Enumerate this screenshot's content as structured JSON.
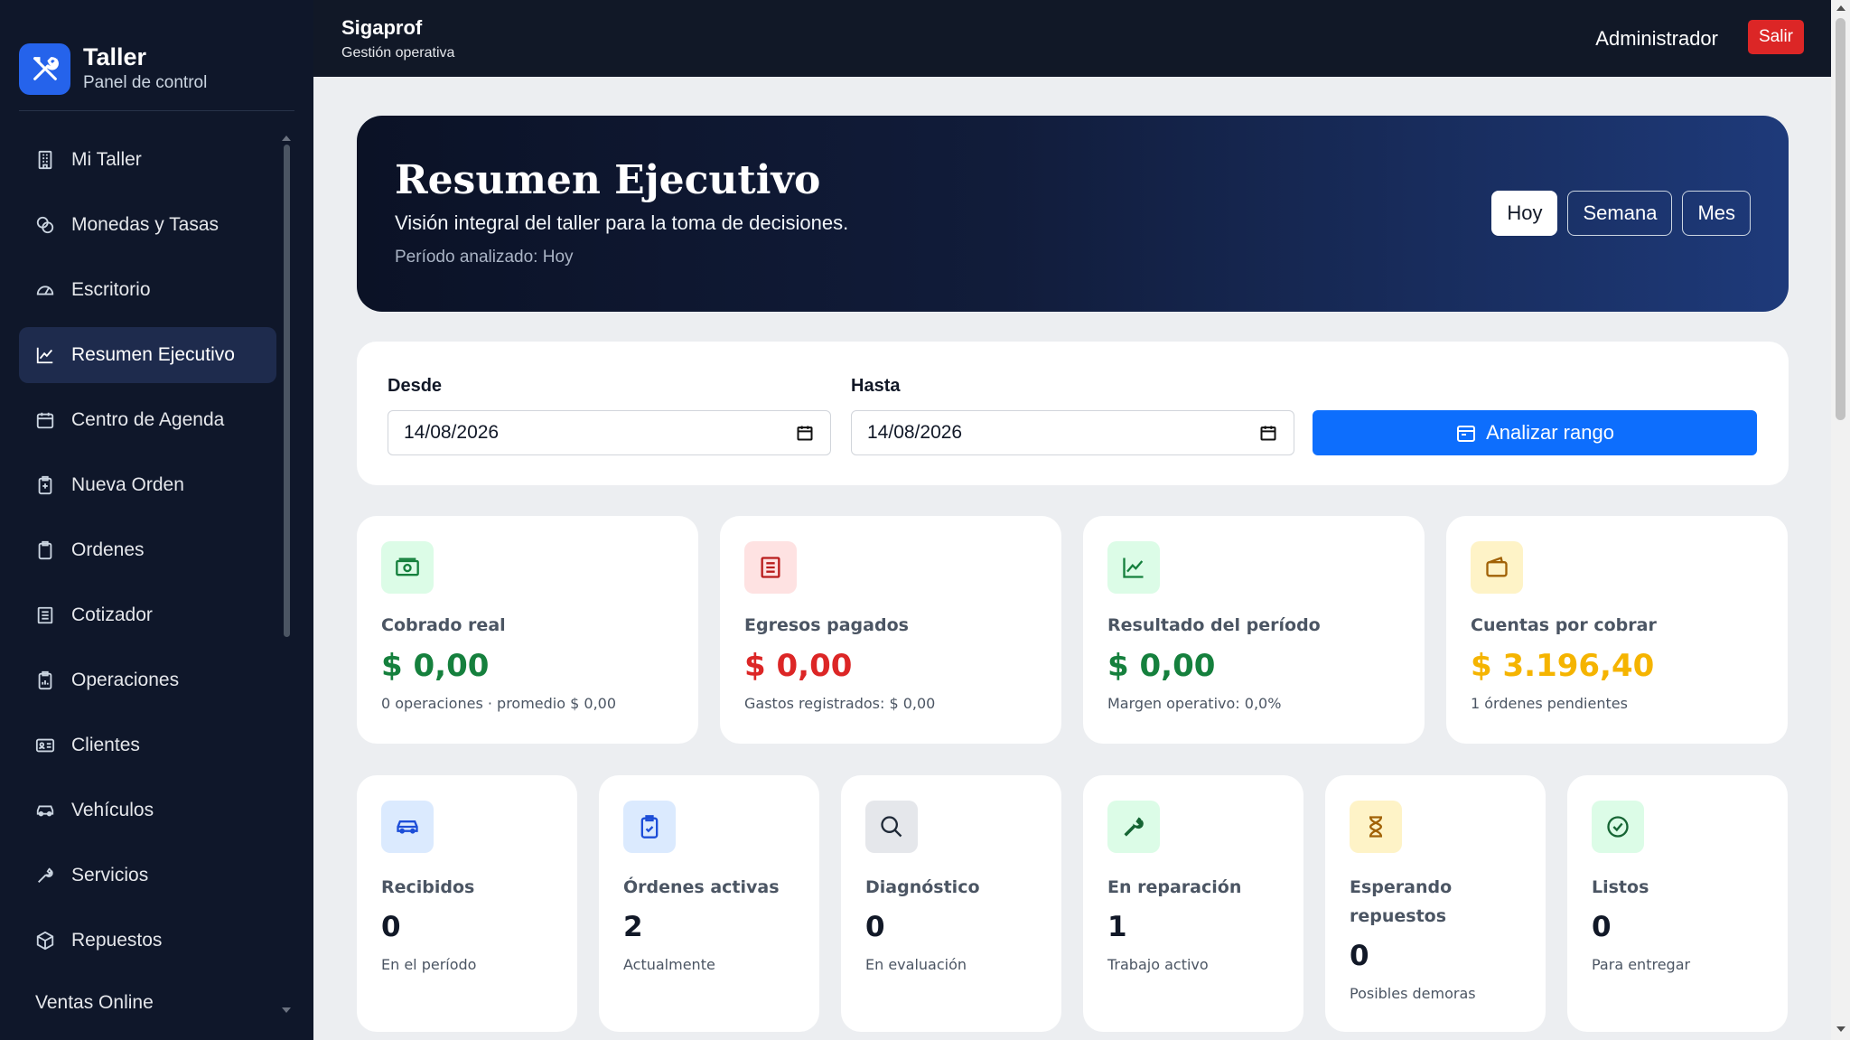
{
  "brand": {
    "title": "Taller",
    "subtitle": "Panel de control"
  },
  "topbar": {
    "app_name": "Sigaprof",
    "app_sub": "Gestión operativa",
    "user": "Administrador",
    "logout": "Salir"
  },
  "sidebar": {
    "items": [
      {
        "label": "Mi Taller",
        "icon": "building-icon"
      },
      {
        "label": "Monedas y Tasas",
        "icon": "coins-icon"
      },
      {
        "label": "Escritorio",
        "icon": "speedometer-icon"
      },
      {
        "label": "Resumen Ejecutivo",
        "icon": "graph-up-icon",
        "active": true
      },
      {
        "label": "Centro de Agenda",
        "icon": "calendar-icon"
      },
      {
        "label": "Nueva Orden",
        "icon": "clipboard-plus-icon"
      },
      {
        "label": "Ordenes",
        "icon": "clipboard-icon"
      },
      {
        "label": "Cotizador",
        "icon": "receipt-icon"
      },
      {
        "label": "Operaciones",
        "icon": "clipboard-data-icon"
      },
      {
        "label": "Clientes",
        "icon": "person-card-icon"
      },
      {
        "label": "Vehículos",
        "icon": "car-icon"
      },
      {
        "label": "Servicios",
        "icon": "wrench-icon"
      },
      {
        "label": "Repuestos",
        "icon": "box-icon"
      },
      {
        "label": "Ventas Online",
        "icon": ""
      }
    ]
  },
  "hero": {
    "title": "Resumen Ejecutivo",
    "subtitle": "Visión integral del taller para la toma de decisiones.",
    "period": "Período analizado: Hoy",
    "buttons": [
      "Hoy",
      "Semana",
      "Mes"
    ],
    "active_button": "Hoy"
  },
  "filter": {
    "from_label": "Desde",
    "from_value": "14/08/2026",
    "to_label": "Hasta",
    "to_value": "14/08/2026",
    "analyze_label": "Analizar rango"
  },
  "kpis": [
    {
      "label": "Cobrado real",
      "value": "$ 0,00",
      "note": "0 operaciones · promedio $ 0,00",
      "color": "#15803d",
      "icon_bg": "#dcfce7",
      "icon": "cash-icon"
    },
    {
      "label": "Egresos pagados",
      "value": "$ 0,00",
      "note": "Gastos registrados: $ 0,00",
      "color": "#dc2626",
      "icon_bg": "#fee2e2",
      "icon": "receipt-icon"
    },
    {
      "label": "Resultado del período",
      "value": "$ 0,00",
      "note": "Margen operativo: 0,0%",
      "color": "#15803d",
      "icon_bg": "#dcfce7",
      "icon": "graph-up-icon"
    },
    {
      "label": "Cuentas por cobrar",
      "value": "$ 3.196,40",
      "note": "1 órdenes pendientes",
      "color": "#f5b400",
      "icon_bg": "#fef3c7",
      "icon": "wallet-icon"
    }
  ],
  "stats": [
    {
      "label": "Recibidos",
      "value": "0",
      "note": "En el período",
      "icon_bg": "#dbeafe",
      "icon": "car-icon"
    },
    {
      "label": "Órdenes activas",
      "value": "2",
      "note": "Actualmente",
      "icon_bg": "#dbeafe",
      "icon": "clipboard-check-icon"
    },
    {
      "label": "Diagnóstico",
      "value": "0",
      "note": "En evaluación",
      "icon_bg": "#e5e7eb",
      "icon": "search-icon"
    },
    {
      "label": "En reparación",
      "value": "1",
      "note": "Trabajo activo",
      "icon_bg": "#dcfce7",
      "icon": "wrench-icon"
    },
    {
      "label": "Esperando repuestos",
      "value": "0",
      "note": "Posibles demoras",
      "icon_bg": "#fef3c7",
      "icon": "hourglass-icon"
    },
    {
      "label": "Listos",
      "value": "0",
      "note": "Para entregar",
      "icon_bg": "#dcfce7",
      "icon": "check-circle-icon"
    }
  ]
}
